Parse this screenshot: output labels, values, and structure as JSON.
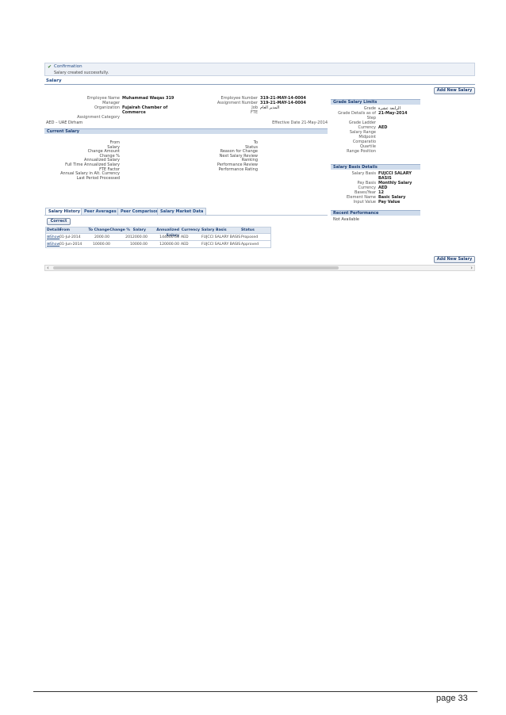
{
  "confirmation": {
    "title": "Confirmation",
    "message": "Salary created successfully."
  },
  "page_title": "Salary",
  "add_button_label": "Add New Salary",
  "employee": {
    "name_label": "Employee Name",
    "name_value": "Muhammad Waqas 319",
    "manager_label": "Manager",
    "organization_label": "Organization",
    "organization_value": "Fujairah Chamber of Commerce",
    "assignment_category_label": "Assignment Category",
    "number_label": "Employee Number",
    "number_value": "319-21-MAY-14-0004",
    "assignment_number_label": "Assignment Number",
    "assignment_number_value": "319-21-MAY-14-0004",
    "job_label": "Job",
    "job_value": "المدير العام",
    "fte_label": "FTE",
    "currency_note": "AED – UAE Dirham",
    "effective_date": "Effective Date 21-May-2014"
  },
  "current_salary": {
    "title": "Current Salary",
    "left_labels": [
      "From",
      "Salary",
      "Change Amount",
      "Change %",
      "Annualized Salary",
      "Full Time Annualized Salary",
      "FTE Factor",
      "Annual Salary in Alt. Currency",
      "Last Period Processed"
    ],
    "right_labels": [
      "To",
      "Status",
      "Reason for Change",
      "Next Salary Review",
      "Ranking",
      "Performance Review",
      "Performance Rating"
    ]
  },
  "grade_limits": {
    "title": "Grade Salary Limits",
    "grade_label": "Grade",
    "grade_value": "الرابعة عشرة",
    "details_as_of_label": "Grade Details as of",
    "details_as_of_value": "21-May-2014",
    "step_label": "Step",
    "grade_ladder_label": "Grade Ladder",
    "currency_label": "Currency",
    "currency_value": "AED",
    "salary_range_label": "Salary Range",
    "midpoint_label": "Midpoint",
    "comparatio_label": "Comparatio",
    "quartile_label": "Quartile",
    "range_position_label": "Range Position"
  },
  "basis": {
    "title": "Salary Basis Details",
    "basis_label": "Salary Basis",
    "basis_value": "FUJCCI SALARY BASIS",
    "pay_basis_label": "Pay Basis",
    "pay_basis_value": "Monthly Salary",
    "currency_label": "Currency",
    "currency_value": "AED",
    "bases_label": "Bases/Year",
    "bases_value": "12",
    "element_label": "Element Name",
    "element_value": "Basic Salary",
    "input_label": "Input Value",
    "input_value": "Pay Value"
  },
  "recent_performance": {
    "title": "Recent Performance",
    "value": "Not Available"
  },
  "tabs": [
    "Salary History",
    "Peer Averages",
    "Peer Comparison",
    "Salary Market Data"
  ],
  "correct_label": "Correct",
  "history": {
    "headers": [
      "Details",
      "From",
      "To",
      "Change",
      "Change %",
      "Salary",
      "Annualized Salary",
      "Currency",
      "Salary Basis",
      "Status"
    ],
    "rows": [
      {
        "details": "Show",
        "from": "01-Jul-2014",
        "to": "",
        "change": "2000.00",
        "change_pct": "20",
        "salary": "12000.00",
        "annualized": "144000.00",
        "currency": "AED",
        "basis": "FUJCCI SALARY BASIS",
        "status": "Proposed"
      },
      {
        "details": "Show",
        "from": "01-Jun-2014",
        "to": "",
        "change": "10000.00",
        "change_pct": "",
        "salary": "10000.00",
        "annualized": "120000.00",
        "currency": "AED",
        "basis": "FUJCCI SALARY BASIS",
        "status": "Approved"
      }
    ]
  },
  "scroll": {
    "left_arrow": "‹",
    "right_arrow": "›"
  },
  "page_number": "page 33"
}
